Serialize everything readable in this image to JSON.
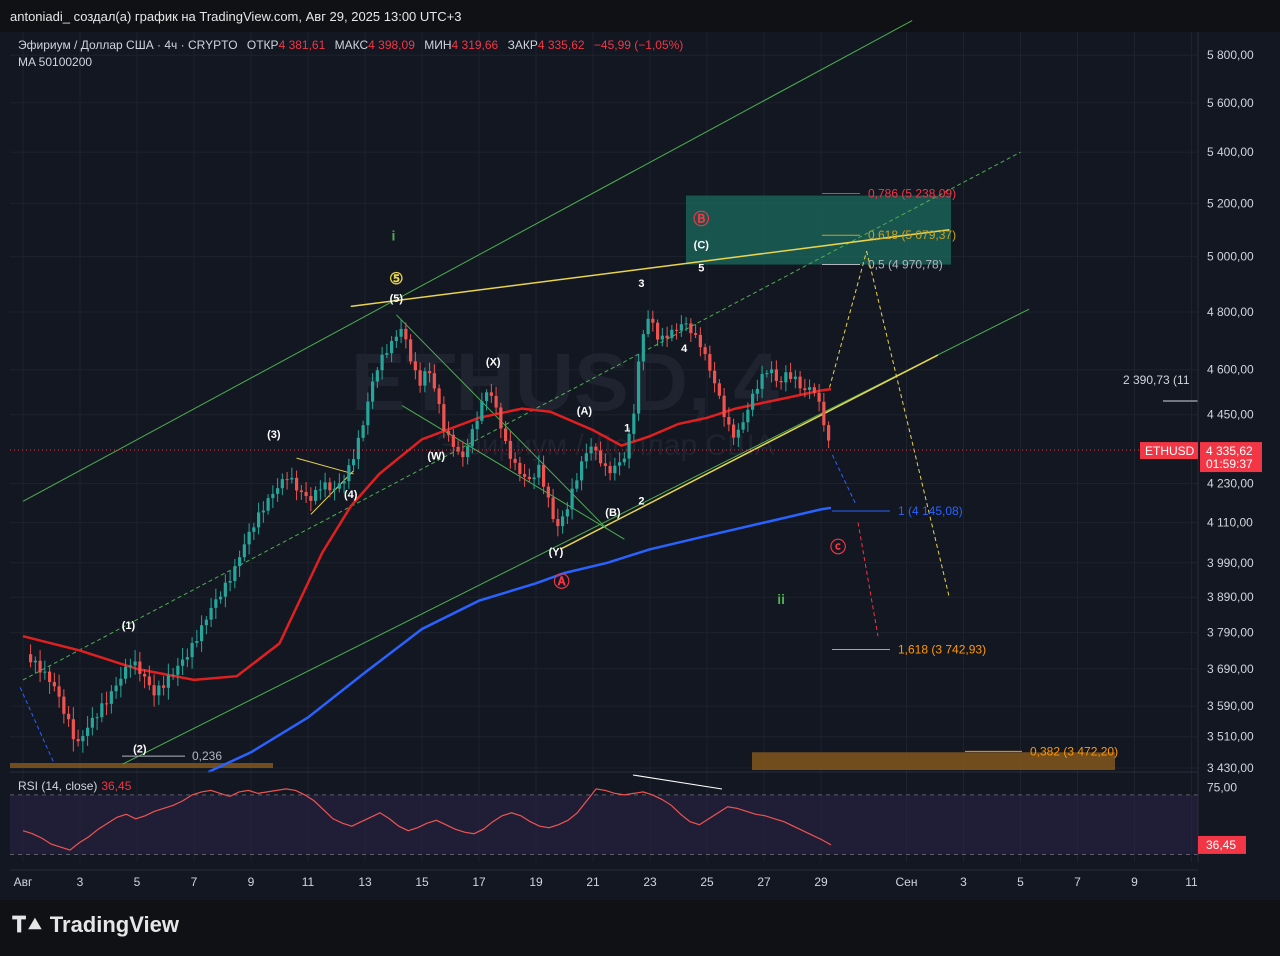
{
  "header": {
    "attribution": "antoniadi_ создал(а) график на TradingView.com, Авг 29, 2025 13:00 UTC+3"
  },
  "legend": {
    "symbol": "Эфириум / Доллар США · 4ч · CRYPTO",
    "open_label": "ОТКР",
    "open": "4 381,61",
    "high_label": "МАКС",
    "high": "4 398,09",
    "low_label": "МИН",
    "low": "4 319,66",
    "close_label": "ЗАКР",
    "close": "4 335,62",
    "change": "−45,99 (−1,05%)",
    "ma": "MA 50100200"
  },
  "watermark": {
    "ticker": "ETHUSD, 4",
    "name": "Эфириум / Доллар США"
  },
  "price_tag": {
    "symbol": "ETHUSD",
    "price": "4 335,62",
    "countdown": "01:59:37",
    "color": "#f23645"
  },
  "rsi": {
    "label": "RSI (14, close)",
    "value": "36,45",
    "scale": [
      "75,00",
      "36,45"
    ]
  },
  "brand": {
    "name": "TradingView",
    "icon": "tradingview-logo-icon"
  },
  "colors": {
    "background": "#131722",
    "bull": "#26a69a",
    "bear": "#ef5350",
    "ma50": "#e02020",
    "ma100": "#2962ff",
    "channel": "#4caf50",
    "trend": "#e8d44d"
  },
  "chart_data": {
    "type": "candlestick",
    "ylim": [
      3430,
      5900
    ],
    "scale": "log",
    "y_ticks": [
      "5 800,00",
      "5 600,00",
      "5 400,00",
      "5 200,00",
      "5 000,00",
      "4 800,00",
      "4 600,00",
      "4 450,00",
      "4 230,00",
      "4 110,00",
      "3 990,00",
      "3 890,00",
      "3 790,00",
      "3 690,00",
      "3 590,00",
      "3 510,00",
      "3 430,00"
    ],
    "y_tick_values": [
      5800,
      5600,
      5400,
      5200,
      5000,
      4800,
      4600,
      4450,
      4230,
      4110,
      3990,
      3890,
      3790,
      3690,
      3590,
      3510,
      3430
    ],
    "x_ticks": [
      "Авг",
      "3",
      "5",
      "7",
      "9",
      "11",
      "13",
      "15",
      "17",
      "19",
      "21",
      "23",
      "25",
      "27",
      "29",
      "Сен",
      "3",
      "5",
      "7",
      "9",
      "11"
    ],
    "x_tick_days": [
      1,
      3,
      5,
      7,
      9,
      11,
      13,
      15,
      17,
      19,
      21,
      23,
      25,
      27,
      29,
      32,
      34,
      36,
      38,
      40,
      42
    ],
    "close_path": [
      [
        1.1,
        3730
      ],
      [
        1.6,
        3690
      ],
      [
        2.1,
        3640
      ],
      [
        2.5,
        3560
      ],
      [
        2.9,
        3480
      ],
      [
        3.2,
        3520
      ],
      [
        3.6,
        3560
      ],
      [
        4.0,
        3600
      ],
      [
        4.4,
        3650
      ],
      [
        4.8,
        3700
      ],
      [
        5.2,
        3660
      ],
      [
        5.6,
        3610
      ],
      [
        6.0,
        3640
      ],
      [
        6.4,
        3680
      ],
      [
        6.8,
        3720
      ],
      [
        7.2,
        3780
      ],
      [
        7.6,
        3850
      ],
      [
        8.0,
        3900
      ],
      [
        8.4,
        3960
      ],
      [
        8.8,
        4050
      ],
      [
        9.2,
        4120
      ],
      [
        9.6,
        4180
      ],
      [
        10.0,
        4230
      ],
      [
        10.3,
        4260
      ],
      [
        10.7,
        4210
      ],
      [
        11.1,
        4190
      ],
      [
        11.5,
        4240
      ],
      [
        11.9,
        4220
      ],
      [
        12.3,
        4260
      ],
      [
        12.6,
        4330
      ],
      [
        12.9,
        4420
      ],
      [
        13.2,
        4550
      ],
      [
        13.5,
        4640
      ],
      [
        13.9,
        4700
      ],
      [
        14.3,
        4760
      ],
      [
        14.6,
        4650
      ],
      [
        14.9,
        4560
      ],
      [
        15.2,
        4620
      ],
      [
        15.5,
        4530
      ],
      [
        15.8,
        4400
      ],
      [
        16.1,
        4360
      ],
      [
        16.4,
        4310
      ],
      [
        16.7,
        4380
      ],
      [
        17.0,
        4460
      ],
      [
        17.3,
        4540
      ],
      [
        17.6,
        4470
      ],
      [
        17.9,
        4360
      ],
      [
        18.2,
        4290
      ],
      [
        18.5,
        4250
      ],
      [
        18.8,
        4230
      ],
      [
        19.1,
        4270
      ],
      [
        19.4,
        4180
      ],
      [
        19.7,
        4080
      ],
      [
        20.0,
        4120
      ],
      [
        20.3,
        4200
      ],
      [
        20.6,
        4280
      ],
      [
        20.9,
        4340
      ],
      [
        21.2,
        4300
      ],
      [
        21.5,
        4250
      ],
      [
        21.8,
        4270
      ],
      [
        22.1,
        4300
      ],
      [
        22.4,
        4420
      ],
      [
        22.7,
        4700
      ],
      [
        23.0,
        4780
      ],
      [
        23.3,
        4690
      ],
      [
        23.6,
        4710
      ],
      [
        23.9,
        4730
      ],
      [
        24.2,
        4760
      ],
      [
        24.5,
        4720
      ],
      [
        24.8,
        4680
      ],
      [
        25.1,
        4600
      ],
      [
        25.4,
        4520
      ],
      [
        25.7,
        4420
      ],
      [
        26.0,
        4380
      ],
      [
        26.3,
        4440
      ],
      [
        26.6,
        4520
      ],
      [
        26.9,
        4580
      ],
      [
        27.2,
        4620
      ],
      [
        27.5,
        4560
      ],
      [
        27.8,
        4600
      ],
      [
        28.1,
        4580
      ],
      [
        28.4,
        4540
      ],
      [
        28.7,
        4560
      ],
      [
        29.0,
        4480
      ],
      [
        29.2,
        4400
      ],
      [
        29.35,
        4335.62
      ]
    ],
    "series": [
      {
        "name": "MA",
        "values": [
          [
            1.0,
            3780
          ],
          [
            3,
            3740
          ],
          [
            5,
            3690
          ],
          [
            7,
            3660
          ],
          [
            8.5,
            3670
          ],
          [
            10,
            3760
          ],
          [
            11.5,
            4020
          ],
          [
            12.5,
            4160
          ],
          [
            13.5,
            4260
          ],
          [
            15,
            4370
          ],
          [
            17,
            4440
          ],
          [
            18.5,
            4470
          ],
          [
            19.5,
            4460
          ],
          [
            21,
            4400
          ],
          [
            22,
            4350
          ],
          [
            23,
            4380
          ],
          [
            24,
            4420
          ],
          [
            25,
            4440
          ],
          [
            26,
            4470
          ],
          [
            27,
            4490
          ],
          [
            28,
            4510
          ],
          [
            29,
            4530
          ],
          [
            29.35,
            4535
          ]
        ]
      },
      {
        "name": "MA",
        "values": [
          [
            7.5,
            3420
          ],
          [
            9,
            3470
          ],
          [
            11,
            3560
          ],
          [
            13,
            3680
          ],
          [
            15,
            3800
          ],
          [
            17,
            3880
          ],
          [
            19,
            3930
          ],
          [
            20,
            3960
          ],
          [
            21.5,
            3990
          ],
          [
            23,
            4030
          ],
          [
            25,
            4070
          ],
          [
            27,
            4110
          ],
          [
            29,
            4150
          ],
          [
            29.35,
            4155
          ]
        ]
      }
    ],
    "levels": [
      {
        "label": "0,786",
        "value": "5 238,09",
        "price": 5238.09
      },
      {
        "label": "0,618",
        "value": "5 079,37",
        "price": 5079.37
      },
      {
        "label": "0,5",
        "value": "4 970,78",
        "price": 4970.78
      },
      {
        "label": "1",
        "value": "4 145,08",
        "price": 4145.08
      },
      {
        "label": "1,618",
        "value": "3 742,93",
        "price": 3742.93
      },
      {
        "label": "0,382",
        "value": "3 472,20",
        "price": 3472.2
      },
      {
        "label": "0,236",
        "value": "",
        "price": 3460
      }
    ],
    "annotation_price": "2 390,73 (11",
    "waves": [
      {
        "text": "(1)",
        "day": 4.7,
        "price": 3800
      },
      {
        "text": "(2)",
        "day": 5.1,
        "price": 3470
      },
      {
        "text": "(3)",
        "day": 9.8,
        "price": 4375
      },
      {
        "text": "(4)",
        "day": 12.5,
        "price": 4185
      },
      {
        "text": "(5)",
        "day": 14.1,
        "price": 4835
      },
      {
        "text": "⑤",
        "day": 14.1,
        "price": 4900
      },
      {
        "text": "i",
        "day": 14.0,
        "price": 5060
      },
      {
        "text": "(W)",
        "day": 15.5,
        "price": 4305
      },
      {
        "text": "(X)",
        "day": 17.5,
        "price": 4615
      },
      {
        "text": "(Y)",
        "day": 19.7,
        "price": 4012
      },
      {
        "text": "Ⓐ",
        "day": 19.9,
        "price": 3920
      },
      {
        "text": "(A)",
        "day": 20.7,
        "price": 4450
      },
      {
        "text": "(B)",
        "day": 21.7,
        "price": 4130
      },
      {
        "text": "1",
        "day": 22.2,
        "price": 4395
      },
      {
        "text": "2",
        "day": 22.7,
        "price": 4165
      },
      {
        "text": "3",
        "day": 22.7,
        "price": 4890
      },
      {
        "text": "4",
        "day": 24.2,
        "price": 4660
      },
      {
        "text": "5",
        "day": 24.8,
        "price": 4945
      },
      {
        "text": "(C)",
        "day": 24.8,
        "price": 5030
      },
      {
        "text": "Ⓑ",
        "day": 24.8,
        "price": 5120
      },
      {
        "text": "ⓒ",
        "day": 29.6,
        "price": 4020
      },
      {
        "text": "ii",
        "day": 27.6,
        "price": 3870
      }
    ],
    "rsi_values": [
      46,
      44,
      41,
      37,
      35,
      33,
      38,
      42,
      47,
      51,
      55,
      57,
      54,
      56,
      59,
      61,
      63,
      66,
      70,
      72,
      73,
      71,
      69,
      72,
      73,
      71,
      72,
      73,
      74,
      73,
      70,
      66,
      60,
      54,
      51,
      49,
      52,
      55,
      58,
      54,
      49,
      46,
      48,
      51,
      53,
      50,
      47,
      45,
      44,
      47,
      52,
      56,
      58,
      56,
      52,
      49,
      48,
      50,
      53,
      58,
      66,
      74,
      73,
      71,
      70,
      71,
      72,
      70,
      67,
      63,
      57,
      52,
      50,
      54,
      58,
      62,
      61,
      59,
      57,
      56,
      54,
      52,
      49,
      46,
      43,
      40,
      36.45
    ],
    "rsi_levels": [
      70,
      30
    ],
    "rsi_ylim": [
      25,
      80
    ]
  }
}
